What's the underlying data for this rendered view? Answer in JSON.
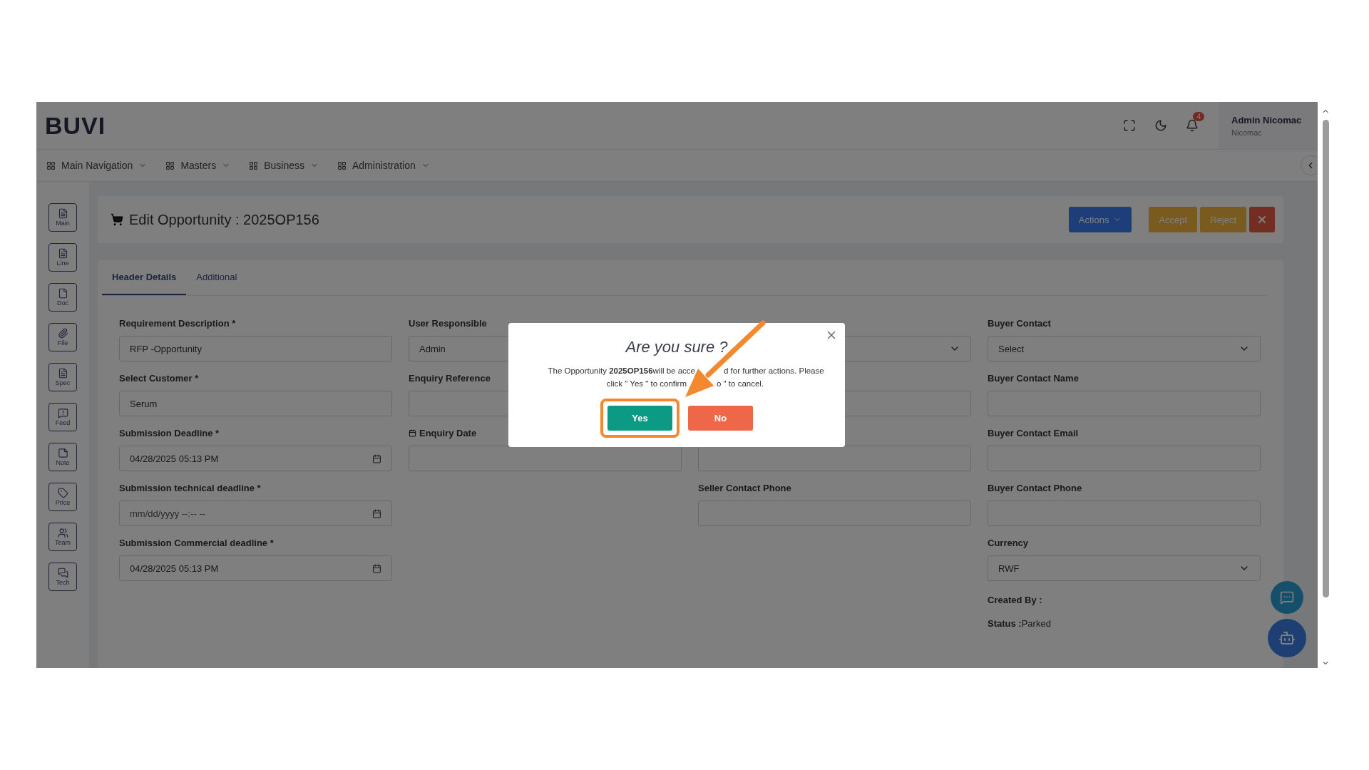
{
  "brand": "BUVI",
  "header": {
    "notification_count": "4",
    "user_name": "Admin Nicomac",
    "user_org": "Nicomac"
  },
  "nav": [
    {
      "label": "Main Navigation"
    },
    {
      "label": "Masters"
    },
    {
      "label": "Business"
    },
    {
      "label": "Administration"
    }
  ],
  "side_tabs": [
    {
      "label": "Main",
      "kind": "list"
    },
    {
      "label": "Line",
      "kind": "list"
    },
    {
      "label": "Doc",
      "kind": "file"
    },
    {
      "label": "File",
      "kind": "clip"
    },
    {
      "label": "Spec",
      "kind": "list"
    },
    {
      "label": "Feed",
      "kind": "alert"
    },
    {
      "label": "Note",
      "kind": "note"
    },
    {
      "label": "Price",
      "kind": "tag"
    },
    {
      "label": "Team",
      "kind": "team"
    },
    {
      "label": "Tech",
      "kind": "chat"
    }
  ],
  "page": {
    "title": "Edit Opportunity : 2025OP156",
    "actions": [
      {
        "label": "Actions",
        "kind": "dropdown"
      },
      {
        "label": "Accept",
        "kind": "warning"
      },
      {
        "label": "Reject",
        "kind": "warning"
      },
      {
        "kind": "close"
      }
    ]
  },
  "tabs": [
    {
      "label": "Header Details",
      "selected": true
    },
    {
      "label": "Additional",
      "selected": false
    }
  ],
  "columns": [
    [
      {
        "label": "Requirement Description *",
        "kind": "text",
        "value": "RFP -Opportunity"
      },
      {
        "label": "Select Customer *",
        "kind": "text",
        "value": "Serum"
      },
      {
        "label": "Submission Deadline *",
        "kind": "date",
        "value": "04/28/2025 05:13 PM"
      },
      {
        "label": "Submission technical deadline *",
        "kind": "date",
        "placeholder": "mm/dd/yyyy --:-- --"
      },
      {
        "label": "Submission Commercial deadline *",
        "kind": "date",
        "value": "04/28/2025 05:13 PM"
      }
    ],
    [
      {
        "label": "User Responsible",
        "kind": "text",
        "value": "Admin"
      },
      {
        "label": "Enquiry Reference",
        "kind": "text"
      },
      {
        "label": "Enquiry Date",
        "kind": "text",
        "label_calendar": true
      }
    ],
    [
      {
        "kind": "select"
      },
      {
        "kind": "text"
      },
      {
        "kind": "text"
      },
      {
        "label": "Seller Contact Phone",
        "kind": "text"
      }
    ],
    [
      {
        "label": "Buyer Contact",
        "kind": "select",
        "value": "Select"
      },
      {
        "label": "Buyer Contact Name",
        "kind": "text"
      },
      {
        "label": "Buyer Contact Email",
        "kind": "text"
      },
      {
        "label": "Buyer Contact Phone",
        "kind": "text"
      },
      {
        "label": "Currency",
        "kind": "select",
        "value": "RWF"
      }
    ]
  ],
  "info": [
    {
      "label": "Created By :"
    },
    {
      "label": "Status :",
      "value": "Parked"
    }
  ],
  "dialog": {
    "title": "Are you sure ?",
    "message_lines": [
      [
        "The Opportunity **2025OP156**will be acce",
        "d for further actions. Please"
      ],
      [
        "click \" Yes \" to confirm",
        "o \" to cancel."
      ]
    ],
    "buttons": [
      {
        "label": "Yes",
        "kind": "confirm",
        "highlighted": true
      },
      {
        "label": "No",
        "kind": "cancel",
        "highlighted": false
      }
    ]
  }
}
